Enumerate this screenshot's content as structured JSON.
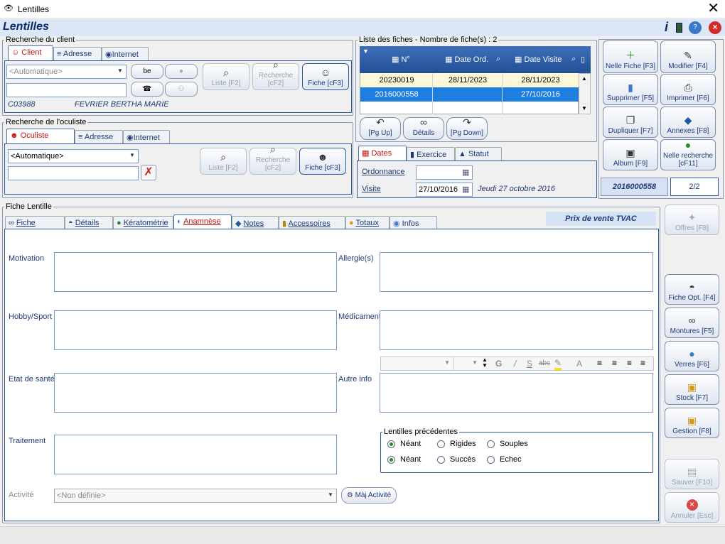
{
  "window": {
    "title": "Lentilles",
    "close": "✕"
  },
  "header": {
    "title": "Lentilles"
  },
  "client_search": {
    "legend": "Recherche du client",
    "tabs": [
      {
        "label": "Client"
      },
      {
        "label": "Adresse"
      },
      {
        "label": "Internet"
      }
    ],
    "combo_value": "<Automatique>",
    "text_value": "",
    "list_btn": "Liste [F2]",
    "search_btn": "Recherche [cF2]",
    "fiche_btn": "Fiche [cF3]",
    "code": "C03988",
    "name": "FEVRIER BERTHA MARIE"
  },
  "oculist_search": {
    "legend": "Recherche de l'oculiste",
    "tabs": [
      {
        "label": "Oculiste"
      },
      {
        "label": "Adresse"
      },
      {
        "label": "Internet"
      }
    ],
    "combo_value": "<Automatique>",
    "list_btn": "Liste [F2]",
    "search_btn": "Recherche [cF2]",
    "fiche_btn": "Fiche [cF3]"
  },
  "files_list": {
    "legend": "Liste des fiches - Nombre de fiche(s) : 2",
    "columns": [
      "N°",
      "Date Ord.",
      "Date Visite"
    ],
    "rows": [
      {
        "num": "20230019",
        "date_ord": "28/11/2023",
        "date_visite": "28/11/2023"
      },
      {
        "num": "2016000558",
        "date_ord": "",
        "date_visite": "27/10/2016"
      }
    ],
    "nav": {
      "up": "[Pg Up]",
      "details": "Détails",
      "down": "[Pg Down]"
    }
  },
  "dates_panel": {
    "tabs": [
      {
        "label": "Dates"
      },
      {
        "label": "Exercice"
      },
      {
        "label": "Statut"
      }
    ],
    "ordonnance_label": "Ordonnance",
    "ordonnance_value": "",
    "visite_label": "Visite",
    "visite_value": "27/10/2016",
    "visite_text": "Jeudi 27 octobre 2016"
  },
  "actions": {
    "new": "Nelle Fiche [F3]",
    "edit": "Modifier [F4]",
    "delete": "Supprimer [F5]",
    "print": "Imprimer [F6]",
    "duplicate": "Dupliquer [F7]",
    "annexes": "Annexes [F8]",
    "album": "Album [F9]",
    "new_search": "Nelle recherche [cF11]",
    "current_num": "2016000558",
    "position": "2/2"
  },
  "fiche": {
    "legend": "Fiche Lentille",
    "tabs": [
      {
        "label": "Fiche"
      },
      {
        "label": "Détails"
      },
      {
        "label": "Kératométrie"
      },
      {
        "label": "Anamnèse"
      },
      {
        "label": "Notes"
      },
      {
        "label": "Accessoires"
      },
      {
        "label": "Totaux"
      },
      {
        "label": "Infos"
      }
    ],
    "price_label": "Prix de vente TVAC",
    "fields": {
      "motivation": "Motivation",
      "allergies": "Allergie(s)",
      "hobby": "Hobby/Sport",
      "medicament": "Médicament",
      "health": "Etat de santé",
      "other": "Autre info",
      "treatment": "Traitement"
    },
    "format_toolbar": {
      "bold": "G",
      "italic": "/",
      "underline": "S",
      "strike": "abc",
      "font": "A"
    },
    "previous": {
      "legend": "Lentilles précédentes",
      "row1": [
        "Néant",
        "Rigides",
        "Souples"
      ],
      "row2": [
        "Néant",
        "Succès",
        "Echec"
      ]
    },
    "activity_label": "Activité",
    "activity_value": "<Non définie>",
    "activity_btn": "Màj Activité"
  },
  "side": {
    "offers": "Offres [F8]",
    "fiche_opt": "Fiche Opt. [F4]",
    "frames": "Montures [F5]",
    "lenses": "Verres [F6]",
    "stock": "Stock [F7]",
    "management": "Gestion [F8]",
    "save": "Sauver [F10]",
    "cancel": "Annuler [Esc]"
  }
}
